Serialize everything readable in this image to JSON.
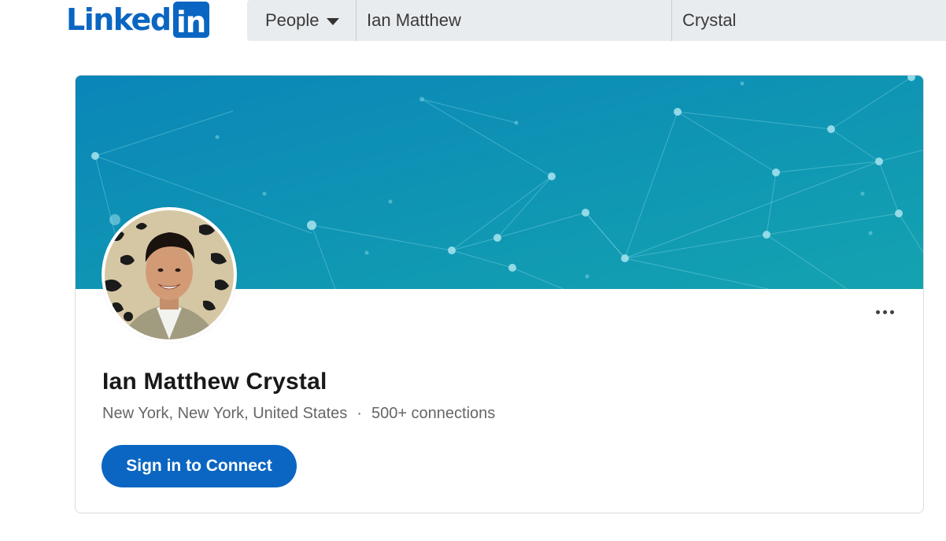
{
  "logo": {
    "text": "Linked",
    "badge": "in"
  },
  "search": {
    "type_label": "People",
    "first_name": "Ian Matthew",
    "last_name": "Crystal"
  },
  "profile": {
    "name": "Ian Matthew Crystal",
    "location": "New York, New York, United States",
    "separator": "·",
    "connections": "500+ connections",
    "connect_label": "Sign in to Connect"
  },
  "colors": {
    "brand": "#0a66c2",
    "banner_start": "#0a86b8",
    "banner_end": "#14a3b0"
  },
  "icons": {
    "dropdown": "caret-down-icon",
    "more": "more-horizontal-icon"
  }
}
